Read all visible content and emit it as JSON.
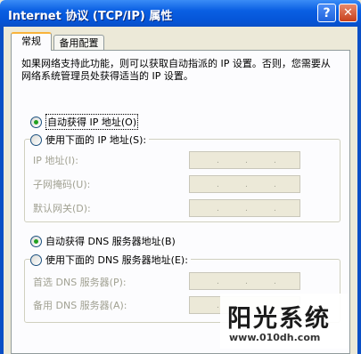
{
  "window": {
    "title": "Internet 协议 (TCP/IP) 属性",
    "help_glyph": "?",
    "close_glyph": "✕"
  },
  "tabs": [
    {
      "label": "常规",
      "selected": true
    },
    {
      "label": "备用配置",
      "selected": false
    }
  ],
  "description": "如果网络支持此功能，则可以获取自动指派的 IP 设置。否则，您需要从网络系统管理员处获得适当的 IP 设置。",
  "ip_section": {
    "auto_option": {
      "label": "自动获得 IP 地址(O)",
      "checked": true
    },
    "manual_option": {
      "label": "使用下面的 IP 地址(S):",
      "checked": false
    },
    "fields": [
      {
        "label": "IP 地址(I):",
        "value": ""
      },
      {
        "label": "子网掩码(U):",
        "value": ""
      },
      {
        "label": "默认网关(D):",
        "value": ""
      }
    ]
  },
  "dns_section": {
    "auto_option": {
      "label": "自动获得 DNS 服务器地址(B)",
      "checked": true
    },
    "manual_option": {
      "label": "使用下面的 DNS 服务器地址(E):",
      "checked": false
    },
    "fields": [
      {
        "label": "首选 DNS 服务器(P):",
        "value": ""
      },
      {
        "label": "备用 DNS 服务器(A):",
        "value": ""
      }
    ]
  },
  "ip_dot": ".",
  "watermark": {
    "text": "阳光系统",
    "url": "www.010dh.com"
  }
}
